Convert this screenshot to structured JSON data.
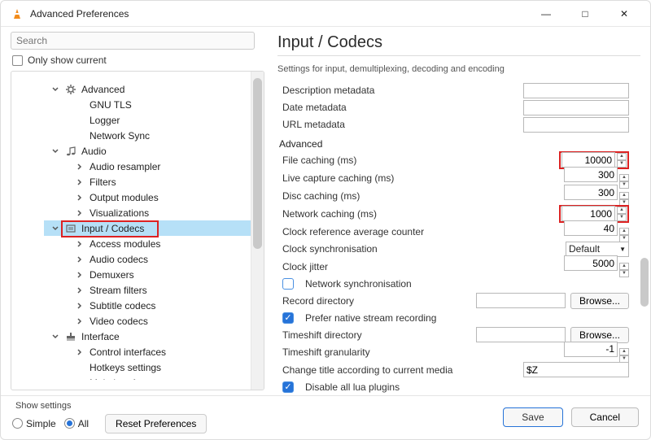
{
  "window": {
    "title": "Advanced Preferences",
    "win_controls": {
      "min": "—",
      "max": "□",
      "close": "✕"
    }
  },
  "search": {
    "placeholder": "Search"
  },
  "only_show_current": "Only show current",
  "tree": [
    {
      "label": "Advanced",
      "icon": "gear",
      "level": 1,
      "state": "open",
      "children": [
        {
          "label": "GNU TLS",
          "level": 2
        },
        {
          "label": "Logger",
          "level": 2
        },
        {
          "label": "Network Sync",
          "level": 2
        }
      ]
    },
    {
      "label": "Audio",
      "icon": "note",
      "level": 1,
      "state": "open",
      "children": [
        {
          "label": "Audio resampler",
          "level": 2,
          "expand": "closed"
        },
        {
          "label": "Filters",
          "level": 2,
          "expand": "closed"
        },
        {
          "label": "Output modules",
          "level": 2,
          "expand": "closed"
        },
        {
          "label": "Visualizations",
          "level": 2,
          "expand": "closed"
        }
      ]
    },
    {
      "label": "Input / Codecs",
      "icon": "codec",
      "level": 1,
      "state": "open",
      "selected": true,
      "highlight": true,
      "children": [
        {
          "label": "Access modules",
          "level": 2,
          "expand": "closed"
        },
        {
          "label": "Audio codecs",
          "level": 2,
          "expand": "closed"
        },
        {
          "label": "Demuxers",
          "level": 2,
          "expand": "closed"
        },
        {
          "label": "Stream filters",
          "level": 2,
          "expand": "closed"
        },
        {
          "label": "Subtitle codecs",
          "level": 2,
          "expand": "closed"
        },
        {
          "label": "Video codecs",
          "level": 2,
          "expand": "closed"
        }
      ]
    },
    {
      "label": "Interface",
      "icon": "brush",
      "level": 1,
      "state": "open",
      "children": [
        {
          "label": "Control interfaces",
          "level": 2,
          "expand": "closed"
        },
        {
          "label": "Hotkeys settings",
          "level": 2
        },
        {
          "label": "Main interfaces",
          "level": 2,
          "expand": "closed"
        }
      ]
    }
  ],
  "page": {
    "title": "Input / Codecs",
    "subtitle": "Settings for input, demultiplexing, decoding and encoding",
    "groups": {
      "meta": [
        {
          "label": "Description metadata",
          "type": "text",
          "value": ""
        },
        {
          "label": "Date metadata",
          "type": "text",
          "value": ""
        },
        {
          "label": "URL metadata",
          "type": "text",
          "value": ""
        }
      ],
      "advanced_head": "Advanced",
      "advanced": [
        {
          "key": "file_caching",
          "label": "File caching (ms)",
          "type": "number",
          "value": "10000",
          "highlight": true
        },
        {
          "key": "live_capture",
          "label": "Live capture caching (ms)",
          "type": "number",
          "value": "300"
        },
        {
          "key": "disc_caching",
          "label": "Disc caching (ms)",
          "type": "number",
          "value": "300"
        },
        {
          "key": "net_caching",
          "label": "Network caching (ms)",
          "type": "number",
          "value": "1000",
          "highlight": true
        },
        {
          "key": "clock_avg",
          "label": "Clock reference average counter",
          "type": "number",
          "value": "40"
        },
        {
          "key": "clock_sync",
          "label": "Clock synchronisation",
          "type": "select",
          "value": "Default"
        },
        {
          "key": "clock_jitter",
          "label": "Clock jitter",
          "type": "number",
          "value": "5000"
        },
        {
          "key": "net_sync",
          "label": "Network synchronisation",
          "type": "check",
          "checked": false
        },
        {
          "key": "record_dir",
          "label": "Record directory",
          "type": "browse",
          "value": "",
          "btn": "Browse..."
        },
        {
          "key": "prefer_native",
          "label": "Prefer native stream recording",
          "type": "check",
          "checked": true
        },
        {
          "key": "timeshift_dir",
          "label": "Timeshift directory",
          "type": "browse",
          "value": "",
          "btn": "Browse..."
        },
        {
          "key": "timeshift_gran",
          "label": "Timeshift granularity",
          "type": "number",
          "value": "-1"
        },
        {
          "key": "change_title",
          "label": "Change title according to current media",
          "type": "text-inline",
          "value": "$Z"
        },
        {
          "key": "disable_lua",
          "label": "Disable all lua plugins",
          "type": "check",
          "checked": true
        }
      ]
    }
  },
  "footer": {
    "show_settings": "Show settings",
    "simple": "Simple",
    "all": "All",
    "reset": "Reset Preferences",
    "save": "Save",
    "cancel": "Cancel"
  }
}
